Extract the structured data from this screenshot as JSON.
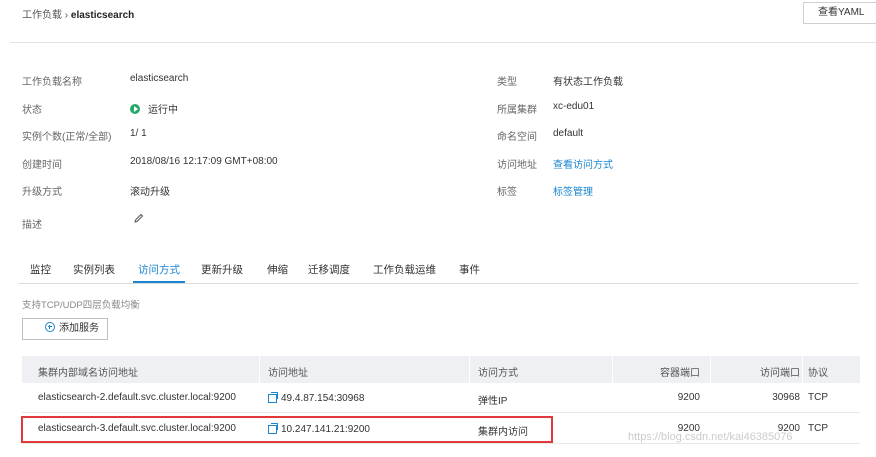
{
  "breadcrumb": {
    "parent": "工作负载",
    "separator": "›",
    "current": "elasticsearch"
  },
  "yaml_button": "查看YAML",
  "info": {
    "left": [
      {
        "label": "工作负载名称",
        "value": "elasticsearch"
      },
      {
        "label": "状态",
        "value": "运行中"
      },
      {
        "label": "实例个数(正常/全部)",
        "value": "1/ 1"
      },
      {
        "label": "创建时间",
        "value": "2018/08/16 12:17:09 GMT+08:00"
      },
      {
        "label": "升级方式",
        "value": "滚动升级"
      },
      {
        "label": "描述",
        "value": ""
      }
    ],
    "right": [
      {
        "label": "类型",
        "value": "有状态工作负载"
      },
      {
        "label": "所属集群",
        "value": "xc-edu01"
      },
      {
        "label": "命名空间",
        "value": "default"
      },
      {
        "label": "访问地址",
        "value": "查看访问方式"
      },
      {
        "label": "标签",
        "value": "标签管理"
      }
    ]
  },
  "tabs": [
    "监控",
    "实例列表",
    "访问方式",
    "更新升级",
    "伸缩",
    "迁移调度",
    "工作负载运维",
    "事件"
  ],
  "active_tab": "访问方式",
  "lb_note": "支持TCP/UDP四层负载均衡",
  "add_service_button": "添加服务",
  "table": {
    "headers": [
      "集群内部域名访问地址",
      "访问地址",
      "访问方式",
      "容器端口",
      "访问端口",
      "协议"
    ],
    "rows": [
      [
        "elasticsearch-2.default.svc.cluster.local:9200",
        "49.4.87.154:30968",
        "弹性IP",
        "9200",
        "30968",
        "TCP"
      ],
      [
        "elasticsearch-3.default.svc.cluster.local:9200",
        "10.247.141.21:9200",
        "集群内访问",
        "9200",
        "9200",
        "TCP"
      ]
    ]
  },
  "watermark": "https://blog.csdn.net/kai46385076",
  "colors": {
    "link": "#1a86d0",
    "status_running": "#27a86a",
    "highlight": "#e0383b",
    "header_bg": "#eef0f3"
  },
  "icons": [
    "play-status-icon",
    "edit-pencil-icon",
    "add-circle-icon",
    "copy-icon"
  ]
}
